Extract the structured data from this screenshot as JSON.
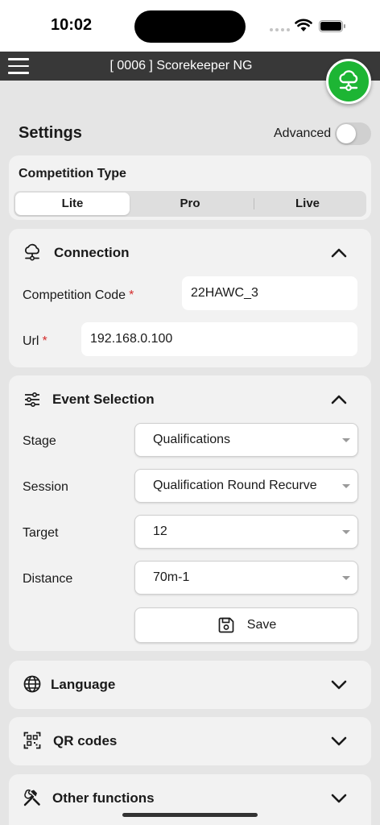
{
  "status_bar": {
    "time": "10:02"
  },
  "header": {
    "title": "[ 0006 ] Scorekeeper NG"
  },
  "settings": {
    "title": "Settings",
    "advanced_label": "Advanced",
    "advanced_enabled": false
  },
  "competition_type": {
    "title": "Competition Type",
    "options": [
      "Lite",
      "Pro",
      "Live"
    ],
    "selected": "Lite"
  },
  "connection": {
    "title": "Connection",
    "code_label": "Competition Code",
    "code_value": "22HAWC_3",
    "url_label": "Url",
    "url_value": "192.168.0.100",
    "required_mark": "*"
  },
  "event_selection": {
    "title": "Event Selection",
    "stage_label": "Stage",
    "stage_value": "Qualifications",
    "session_label": "Session",
    "session_value": "Qualification Round Recurve",
    "target_label": "Target",
    "target_value": "12",
    "distance_label": "Distance",
    "distance_value": "70m-1",
    "save_label": "Save"
  },
  "sections": {
    "language": "Language",
    "qr_codes": "QR codes",
    "other_functions": "Other functions"
  },
  "colors": {
    "header_bg": "#383838",
    "fab_green": "#1db534",
    "required_red": "#d42c2c",
    "page_bg": "#e5e5e5",
    "card_bg": "#f2f2f2"
  }
}
